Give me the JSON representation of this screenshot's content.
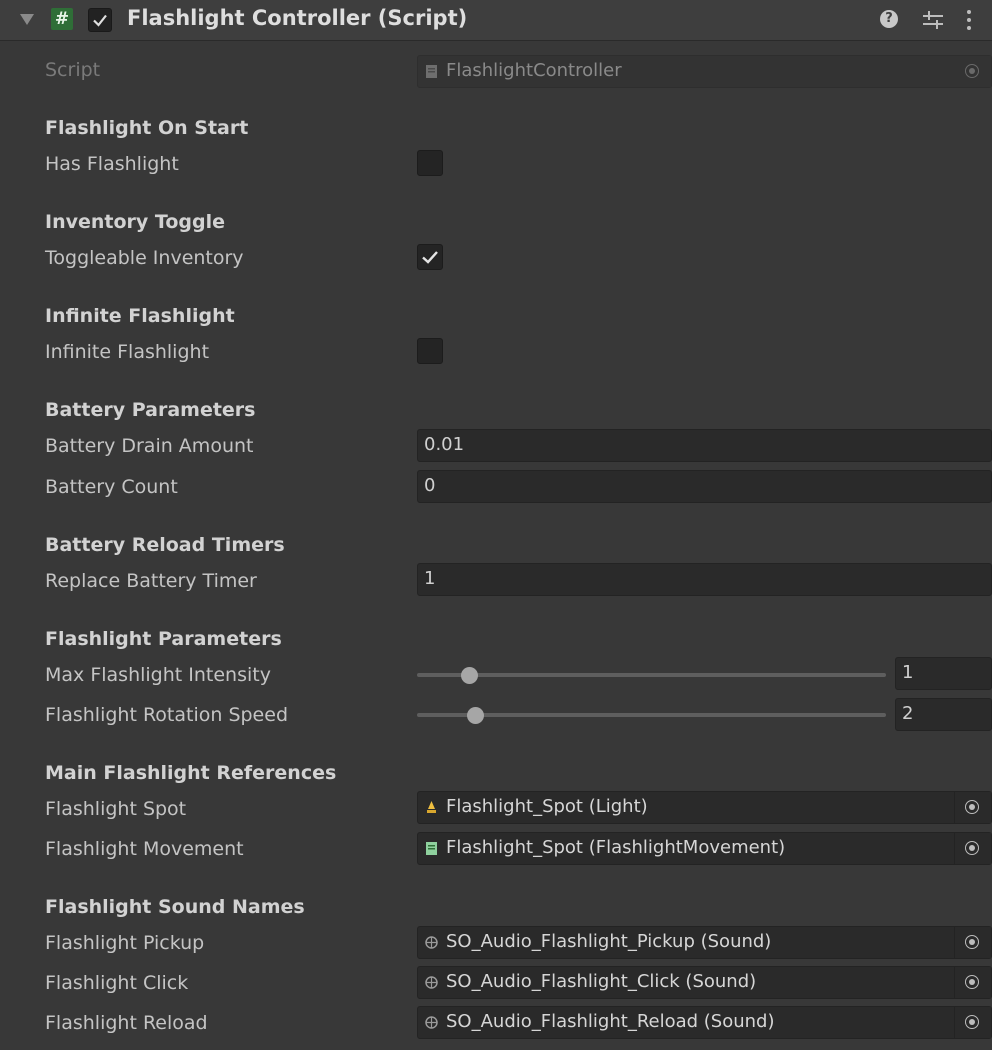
{
  "header": {
    "title": "Flashlight Controller (Script)",
    "script_icon": "#",
    "enabled": true
  },
  "script": {
    "label": "Script",
    "value": "FlashlightController"
  },
  "sections": {
    "on_start": {
      "heading": "Flashlight On Start",
      "has_flashlight": {
        "label": "Has Flashlight",
        "checked": false
      }
    },
    "inventory": {
      "heading": "Inventory Toggle",
      "toggleable": {
        "label": "Toggleable Inventory",
        "checked": true
      }
    },
    "infinite": {
      "heading": "Infinite Flashlight",
      "infinite": {
        "label": "Infinite Flashlight",
        "checked": false
      }
    },
    "battery": {
      "heading": "Battery Parameters",
      "drain": {
        "label": "Battery Drain Amount",
        "value": "0.01"
      },
      "count": {
        "label": "Battery Count",
        "value": "0"
      }
    },
    "reload": {
      "heading": "Battery Reload Timers",
      "replace": {
        "label": "Replace Battery Timer",
        "value": "1"
      }
    },
    "params": {
      "heading": "Flashlight Parameters",
      "intensity": {
        "label": "Max Flashlight Intensity",
        "value": "1"
      },
      "rotation": {
        "label": "Flashlight Rotation Speed",
        "value": "2"
      }
    },
    "references": {
      "heading": "Main Flashlight References",
      "spot": {
        "label": "Flashlight Spot",
        "value": "Flashlight_Spot (Light)"
      },
      "movement": {
        "label": "Flashlight Movement",
        "value": "Flashlight_Spot (FlashlightMovement)"
      }
    },
    "sounds": {
      "heading": "Flashlight Sound Names",
      "pickup": {
        "label": "Flashlight Pickup",
        "value": "SO_Audio_Flashlight_Pickup (Sound)"
      },
      "click": {
        "label": "Flashlight Click",
        "value": "SO_Audio_Flashlight_Click (Sound)"
      },
      "reload": {
        "label": "Flashlight Reload",
        "value": "SO_Audio_Flashlight_Reload (Sound)"
      }
    }
  },
  "icons": {
    "foldout": "triangle-down-icon",
    "help": "question-circle-icon",
    "presets": "sliders-icon",
    "menu": "kebab-menu-icon",
    "object_picker": "target-circle-icon",
    "light": "light-bulb-icon",
    "script": "script-file-icon",
    "sound": "scriptable-object-icon"
  },
  "colors": {
    "background": "#383838",
    "header": "#3e3e3e",
    "field": "#2a2a2a",
    "script_icon_green": "#2f6e37"
  }
}
